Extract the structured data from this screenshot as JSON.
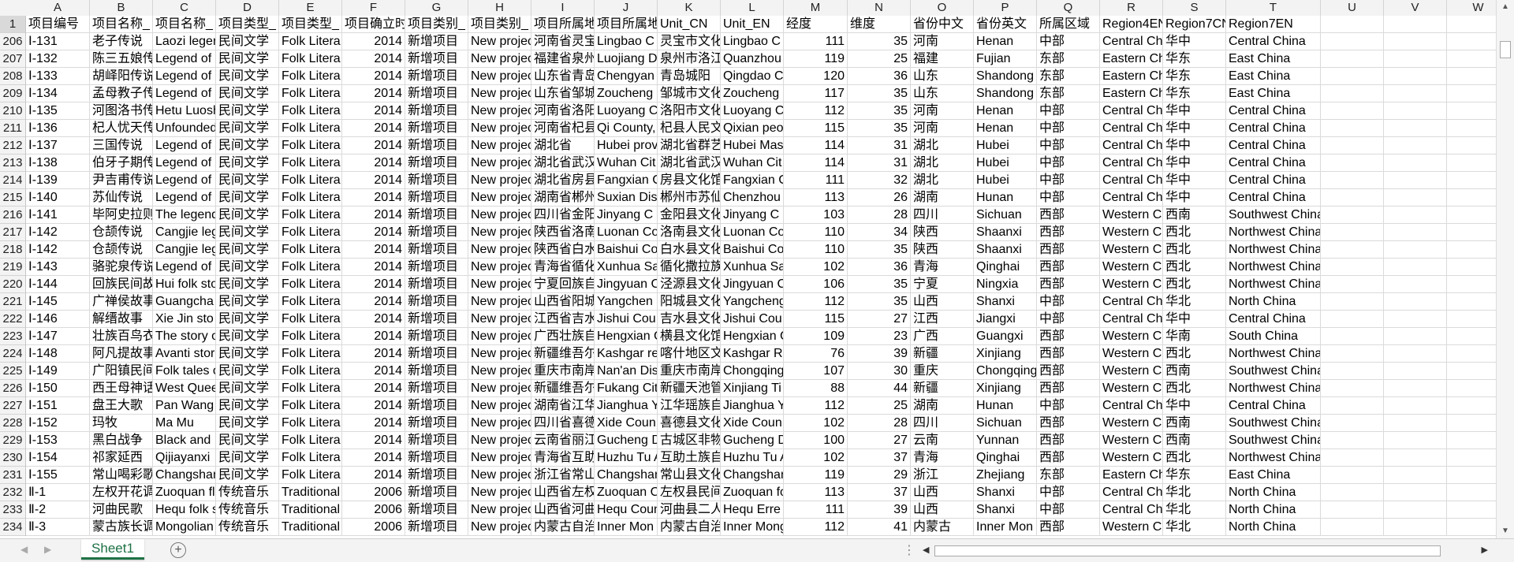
{
  "sheet": {
    "columns": [
      "A",
      "B",
      "C",
      "D",
      "E",
      "F",
      "G",
      "H",
      "I",
      "J",
      "K",
      "L",
      "M",
      "N",
      "O",
      "P",
      "Q",
      "R",
      "S",
      "T",
      "U",
      "V",
      "W"
    ],
    "header_row_number": "1",
    "header_row": [
      "项目编号",
      "项目名称_",
      "项目名称_",
      "项目类型_",
      "项目类型_",
      "项目确立时",
      "项目类别_",
      "项目类别_",
      "项目所属地",
      "项目所属地",
      "Unit_CN",
      "Unit_EN",
      "经度",
      "维度",
      "省份中文",
      "省份英文",
      "所属区域",
      "Region4EN",
      "Region7CN",
      "Region7EN",
      "",
      "",
      ""
    ],
    "rows": [
      {
        "n": "206",
        "c": [
          "Ⅰ-131",
          "老子传说",
          "Laozi legen",
          "民间文学",
          "Folk Litera",
          "2014",
          "新增项目",
          "New projec",
          "河南省灵宝",
          "Lingbao C",
          "灵宝市文化",
          "Lingbao C",
          "111",
          "35",
          "河南",
          "Henan",
          "中部",
          "Central Ch",
          "华中",
          "Central China",
          "",
          "",
          ""
        ]
      },
      {
        "n": "207",
        "c": [
          "Ⅰ-132",
          "陈三五娘传",
          "Legend of",
          "民间文学",
          "Folk Litera",
          "2014",
          "新增项目",
          "New projec",
          "福建省泉州",
          "Luojiang D",
          "泉州市洛江",
          "Quanzhou",
          "119",
          "25",
          "福建",
          "Fujian",
          "东部",
          "Eastern Ch",
          "华东",
          "East China",
          "",
          "",
          ""
        ]
      },
      {
        "n": "208",
        "c": [
          "Ⅰ-133",
          "胡峄阳传说",
          "Legend of",
          "民间文学",
          "Folk Litera",
          "2014",
          "新增项目",
          "New projec",
          "山东省青岛",
          "Chengyan",
          "青岛城阳",
          "Qingdao C",
          "120",
          "36",
          "山东",
          "Shandong",
          "东部",
          "Eastern Ch",
          "华东",
          "East China",
          "",
          "",
          ""
        ]
      },
      {
        "n": "209",
        "c": [
          "Ⅰ-134",
          "孟母教子传",
          "Legend of",
          "民间文学",
          "Folk Litera",
          "2014",
          "新增项目",
          "New projec",
          "山东省邹城",
          "Zoucheng",
          "邹城市文化",
          "Zoucheng",
          "117",
          "35",
          "山东",
          "Shandong",
          "东部",
          "Eastern Ch",
          "华东",
          "East China",
          "",
          "",
          ""
        ]
      },
      {
        "n": "210",
        "c": [
          "Ⅰ-135",
          "河图洛书传",
          "Hetu Luosh",
          "民间文学",
          "Folk Litera",
          "2014",
          "新增项目",
          "New projec",
          "河南省洛阳",
          "Luoyang C",
          "洛阳市文化",
          "Luoyang C",
          "112",
          "35",
          "河南",
          "Henan",
          "中部",
          "Central Ch",
          "华中",
          "Central China",
          "",
          "",
          ""
        ]
      },
      {
        "n": "211",
        "c": [
          "Ⅰ-136",
          "杞人忧天传",
          "Unfounded",
          "民间文学",
          "Folk Litera",
          "2014",
          "新增项目",
          "New projec",
          "河南省杞县",
          "Qi County,",
          "杞县人民文",
          "Qixian peo",
          "115",
          "35",
          "河南",
          "Henan",
          "中部",
          "Central Ch",
          "华中",
          "Central China",
          "",
          "",
          ""
        ]
      },
      {
        "n": "212",
        "c": [
          "Ⅰ-137",
          "三国传说",
          "Legend of",
          "民间文学",
          "Folk Litera",
          "2014",
          "新增项目",
          "New projec",
          "湖北省",
          "Hubei prov",
          "湖北省群艺",
          "Hubei Mas",
          "114",
          "31",
          "湖北",
          "Hubei",
          "中部",
          "Central Ch",
          "华中",
          "Central China",
          "",
          "",
          ""
        ]
      },
      {
        "n": "213",
        "c": [
          "Ⅰ-138",
          "伯牙子期传",
          "Legend of",
          "民间文学",
          "Folk Litera",
          "2014",
          "新增项目",
          "New projec",
          "湖北省武汉",
          "Wuhan Cit",
          "湖北省武汉",
          "Wuhan Cit",
          "114",
          "31",
          "湖北",
          "Hubei",
          "中部",
          "Central Ch",
          "华中",
          "Central China",
          "",
          "",
          ""
        ]
      },
      {
        "n": "214",
        "c": [
          "Ⅰ-139",
          "尹吉甫传说",
          "Legend of",
          "民间文学",
          "Folk Litera",
          "2014",
          "新增项目",
          "New projec",
          "湖北省房县",
          "Fangxian C",
          "房县文化馆",
          "Fangxian C",
          "111",
          "32",
          "湖北",
          "Hubei",
          "中部",
          "Central Ch",
          "华中",
          "Central China",
          "",
          "",
          ""
        ]
      },
      {
        "n": "215",
        "c": [
          "Ⅰ-140",
          "苏仙传说",
          "Legend of",
          "民间文学",
          "Folk Litera",
          "2014",
          "新增项目",
          "New projec",
          "湖南省郴州",
          "Suxian Dis",
          "郴州市苏仙",
          "Chenzhou",
          "113",
          "26",
          "湖南",
          "Hunan",
          "中部",
          "Central Ch",
          "华中",
          "Central China",
          "",
          "",
          ""
        ]
      },
      {
        "n": "216",
        "c": [
          "Ⅰ-141",
          "毕阿史拉则",
          "The legend",
          "民间文学",
          "Folk Litera",
          "2014",
          "新增项目",
          "New projec",
          "四川省金阳",
          "Jinyang C",
          "金阳县文化",
          "Jinyang C",
          "103",
          "28",
          "四川",
          "Sichuan",
          "西部",
          "Western C",
          "西南",
          "Southwest China",
          "",
          "",
          ""
        ]
      },
      {
        "n": "217",
        "c": [
          "Ⅰ-142",
          "仓颉传说",
          "Cangjie leg",
          "民间文学",
          "Folk Litera",
          "2014",
          "新增项目",
          "New projec",
          "陕西省洛南",
          "Luonan Co",
          "洛南县文化",
          "Luonan Co",
          "110",
          "34",
          "陕西",
          "Shaanxi",
          "西部",
          "Western C",
          "西北",
          "Northwest China",
          "",
          "",
          ""
        ]
      },
      {
        "n": "218",
        "c": [
          "Ⅰ-142",
          "仓颉传说",
          "Cangjie leg",
          "民间文学",
          "Folk Litera",
          "2014",
          "新增项目",
          "New projec",
          "陕西省白水",
          "Baishui Co",
          "白水县文化",
          "Baishui Co",
          "110",
          "35",
          "陕西",
          "Shaanxi",
          "西部",
          "Western C",
          "西北",
          "Northwest China",
          "",
          "",
          ""
        ]
      },
      {
        "n": "219",
        "c": [
          "Ⅰ-143",
          "骆驼泉传说",
          "Legend of",
          "民间文学",
          "Folk Litera",
          "2014",
          "新增项目",
          "New projec",
          "青海省循化",
          "Xunhua Sa",
          "循化撒拉族",
          "Xunhua Sa",
          "102",
          "36",
          "青海",
          "Qinghai",
          "西部",
          "Western C",
          "西北",
          "Northwest China",
          "",
          "",
          ""
        ]
      },
      {
        "n": "220",
        "c": [
          "Ⅰ-144",
          "回族民间故",
          "Hui folk sto",
          "民间文学",
          "Folk Litera",
          "2014",
          "新增项目",
          "New projec",
          "宁夏回族自",
          "Jingyuan C",
          "泾源县文化",
          "Jingyuan C",
          "106",
          "35",
          "宁夏",
          "Ningxia",
          "西部",
          "Western C",
          "西北",
          "Northwest China",
          "",
          "",
          ""
        ]
      },
      {
        "n": "221",
        "c": [
          "Ⅰ-145",
          "广禅侯故事",
          "Guangcha",
          "民间文学",
          "Folk Litera",
          "2014",
          "新增项目",
          "New projec",
          "山西省阳城",
          "Yangchen",
          "阳城县文化",
          "Yangcheng",
          "112",
          "35",
          "山西",
          "Shanxi",
          "中部",
          "Central Ch",
          "华北",
          "North China",
          "",
          "",
          ""
        ]
      },
      {
        "n": "222",
        "c": [
          "Ⅰ-146",
          "解缙故事",
          "Xie Jin sto",
          "民间文学",
          "Folk Litera",
          "2014",
          "新增项目",
          "New projec",
          "江西省吉水",
          "Jishui Cou",
          "吉水县文化",
          "Jishui Cou",
          "115",
          "27",
          "江西",
          "Jiangxi",
          "中部",
          "Central Ch",
          "华中",
          "Central China",
          "",
          "",
          ""
        ]
      },
      {
        "n": "223",
        "c": [
          "Ⅰ-147",
          "壮族百鸟衣",
          "The story o",
          "民间文学",
          "Folk Litera",
          "2014",
          "新增项目",
          "New projec",
          "广西壮族自",
          "Hengxian C",
          "横县文化馆",
          "Hengxian C",
          "109",
          "23",
          "广西",
          "Guangxi",
          "西部",
          "Western C",
          "华南",
          "South China",
          "",
          "",
          ""
        ]
      },
      {
        "n": "224",
        "c": [
          "Ⅰ-148",
          "阿凡提故事",
          "Avanti stor",
          "民间文学",
          "Folk Litera",
          "2014",
          "新增项目",
          "New projec",
          "新疆维吾尔",
          "Kashgar re",
          "喀什地区文",
          "Kashgar R",
          "76",
          "39",
          "新疆",
          "Xinjiang",
          "西部",
          "Western C",
          "西北",
          "Northwest China",
          "",
          "",
          ""
        ]
      },
      {
        "n": "225",
        "c": [
          "Ⅰ-149",
          "广阳镇民间",
          "Folk tales o",
          "民间文学",
          "Folk Litera",
          "2014",
          "新增项目",
          "New projec",
          "重庆市南岸",
          "Nan'an Dis",
          "重庆市南岸",
          "Chongqing",
          "107",
          "30",
          "重庆",
          "Chongqing",
          "西部",
          "Western C",
          "西南",
          "Southwest China",
          "",
          "",
          ""
        ]
      },
      {
        "n": "226",
        "c": [
          "Ⅰ-150",
          "西王母神话",
          "West Quee",
          "民间文学",
          "Folk Litera",
          "2014",
          "新增项目",
          "New projec",
          "新疆维吾尔",
          "Fukang Cit",
          "新疆天池管",
          "Xinjiang Ti",
          "88",
          "44",
          "新疆",
          "Xinjiang",
          "西部",
          "Western C",
          "西北",
          "Northwest China",
          "",
          "",
          ""
        ]
      },
      {
        "n": "227",
        "c": [
          "Ⅰ-151",
          "盘王大歌",
          "Pan Wang",
          "民间文学",
          "Folk Litera",
          "2014",
          "新增项目",
          "New projec",
          "湖南省江华",
          "Jianghua Y",
          "江华瑶族自",
          "Jianghua Y",
          "112",
          "25",
          "湖南",
          "Hunan",
          "中部",
          "Central Ch",
          "华中",
          "Central China",
          "",
          "",
          ""
        ]
      },
      {
        "n": "228",
        "c": [
          "Ⅰ-152",
          "玛牧",
          "Ma Mu",
          "民间文学",
          "Folk Litera",
          "2014",
          "新增项目",
          "New projec",
          "四川省喜德",
          "Xide Coun",
          "喜德县文化",
          "Xide Coun",
          "102",
          "28",
          "四川",
          "Sichuan",
          "西部",
          "Western C",
          "西南",
          "Southwest China",
          "",
          "",
          ""
        ]
      },
      {
        "n": "229",
        "c": [
          "Ⅰ-153",
          "黑白战争",
          "Black and",
          "民间文学",
          "Folk Litera",
          "2014",
          "新增项目",
          "New projec",
          "云南省丽江",
          "Gucheng D",
          "古城区非物",
          "Gucheng D",
          "100",
          "27",
          "云南",
          "Yunnan",
          "西部",
          "Western C",
          "西南",
          "Southwest China",
          "",
          "",
          ""
        ]
      },
      {
        "n": "230",
        "c": [
          "Ⅰ-154",
          "祁家延西",
          "Qijiayanxi",
          "民间文学",
          "Folk Litera",
          "2014",
          "新增项目",
          "New projec",
          "青海省互助",
          "Huzhu Tu A",
          "互助土族自",
          "Huzhu Tu A",
          "102",
          "37",
          "青海",
          "Qinghai",
          "西部",
          "Western C",
          "西北",
          "Northwest China",
          "",
          "",
          ""
        ]
      },
      {
        "n": "231",
        "c": [
          "Ⅰ-155",
          "常山喝彩歌",
          "Changshan",
          "民间文学",
          "Folk Litera",
          "2014",
          "新增项目",
          "New projec",
          "浙江省常山",
          "Changshan",
          "常山县文化",
          "Changshan",
          "119",
          "29",
          "浙江",
          "Zhejiang",
          "东部",
          "Eastern Ch",
          "华东",
          "East China",
          "",
          "",
          ""
        ]
      },
      {
        "n": "232",
        "c": [
          "Ⅱ-1",
          "左权开花调",
          "Zuoquan fl",
          "传统音乐",
          "Traditional",
          "2006",
          "新增项目",
          "New projec",
          "山西省左权",
          "Zuoquan C",
          "左权县民间",
          "Zuoquan fo",
          "113",
          "37",
          "山西",
          "Shanxi",
          "中部",
          "Central Ch",
          "华北",
          "North China",
          "",
          "",
          ""
        ]
      },
      {
        "n": "233",
        "c": [
          "Ⅱ-2",
          "河曲民歌",
          "Hequ folk s",
          "传统音乐",
          "Traditional",
          "2006",
          "新增项目",
          "New projec",
          "山西省河曲",
          "Hequ Coun",
          "河曲县二人",
          "Hequ Erre",
          "111",
          "39",
          "山西",
          "Shanxi",
          "中部",
          "Central Ch",
          "华北",
          "North China",
          "",
          "",
          ""
        ]
      },
      {
        "n": "234",
        "c": [
          "Ⅱ-3",
          "蒙古族长调",
          "Mongolian",
          "传统音乐",
          "Traditional",
          "2006",
          "新增项目",
          "New projec",
          "内蒙古自治",
          "Inner Mon",
          "内蒙古自治",
          "Inner Mong",
          "112",
          "41",
          "内蒙古",
          "Inner Mon",
          "西部",
          "Western C",
          "华北",
          "North China",
          "",
          "",
          ""
        ]
      }
    ]
  },
  "tabs": {
    "sheet1": "Sheet1",
    "add_label": "+"
  },
  "scroll": {
    "left_arrow": "◀",
    "right_arrow": "▶",
    "up_arrow": "▲",
    "down_arrow": "▼",
    "ellipsis": "⋮"
  },
  "colors": {
    "accent": "#1e7145",
    "header_bg": "#f3f3f3",
    "grid_line": "#dadada"
  }
}
